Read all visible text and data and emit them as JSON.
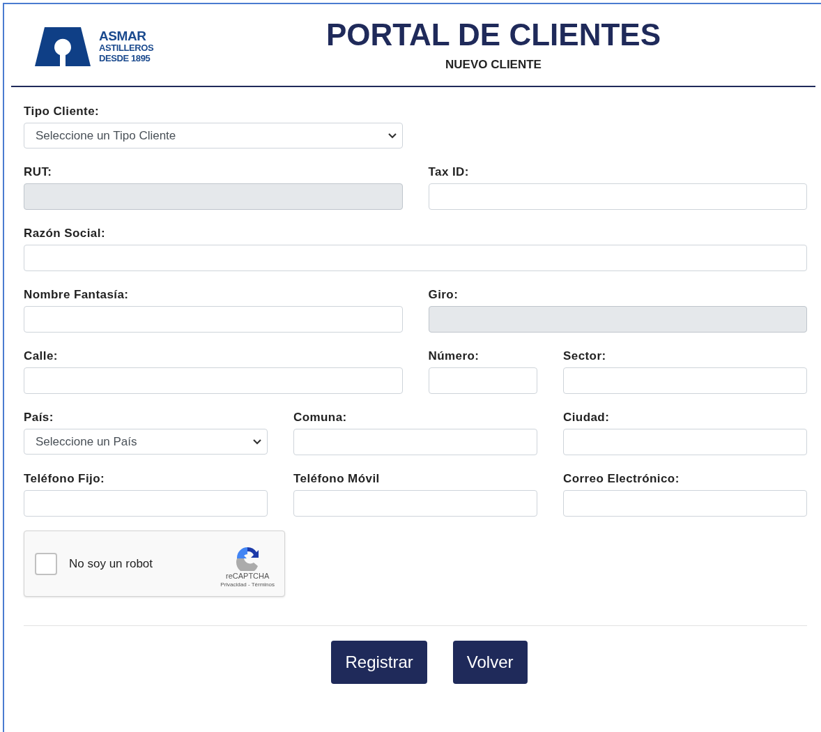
{
  "header": {
    "logo": {
      "name": "ASMAR",
      "line_1": "ASTILLEROS",
      "line_2": "DESDE 1895"
    },
    "title": "PORTAL DE CLIENTES",
    "subtitle": "NUEVO CLIENTE"
  },
  "form_rows": [
    [
      {
        "label": "Tipo Cliente:",
        "kind": "select",
        "value": "Seleccione un Tipo Cliente",
        "disabled": false
      }
    ],
    [
      {
        "label": "RUT:",
        "kind": "input",
        "disabled": true
      },
      {
        "label": "Tax ID:",
        "kind": "input",
        "disabled": false
      }
    ],
    [
      {
        "label": "Razón Social:",
        "kind": "input",
        "disabled": false
      }
    ],
    [
      {
        "label": "Nombre Fantasía:",
        "kind": "input",
        "disabled": false
      },
      {
        "label": "Giro:",
        "kind": "input",
        "disabled": true
      }
    ],
    [
      {
        "label": "Calle:",
        "kind": "input",
        "disabled": false
      },
      {
        "label": "Número:",
        "kind": "input",
        "disabled": false
      },
      {
        "label": "Sector:",
        "kind": "input",
        "disabled": false
      }
    ],
    [
      {
        "label": "País:",
        "kind": "select",
        "value": "Seleccione un País",
        "disabled": false
      },
      {
        "label": "Comuna:",
        "kind": "input",
        "disabled": false
      },
      {
        "label": "Ciudad:",
        "kind": "input",
        "disabled": false
      }
    ],
    [
      {
        "label": "Teléfono Fijo:",
        "kind": "input",
        "disabled": false
      },
      {
        "label": "Teléfono Móvil",
        "kind": "input",
        "disabled": false
      },
      {
        "label": "Correo Electrónico:",
        "kind": "input",
        "disabled": false
      }
    ]
  ],
  "captcha": {
    "label": "No soy un robot",
    "checked": false,
    "brand": "reCAPTCHA",
    "links": "Privacidad - Términos"
  },
  "buttons": [
    "Registrar",
    "Volver"
  ]
}
